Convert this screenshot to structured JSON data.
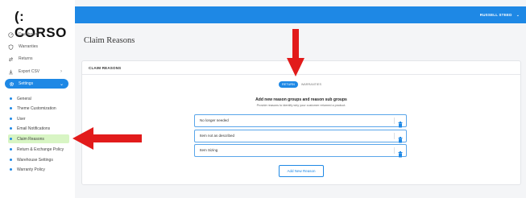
{
  "brand": {
    "logo_text": "CORSO"
  },
  "topbar": {
    "user_name": "RUSSELL STEED"
  },
  "sidebar": {
    "items": [
      {
        "label": "Dashboard",
        "icon": "dashboard-icon"
      },
      {
        "label": "Warranties",
        "icon": "shield-icon"
      },
      {
        "label": "Returns",
        "icon": "returns-icon"
      },
      {
        "label": "Export CSV",
        "icon": "download-icon"
      }
    ],
    "settings_label": "Settings",
    "sub_items": [
      {
        "label": "General"
      },
      {
        "label": "Theme Customization"
      },
      {
        "label": "User"
      },
      {
        "label": "Email Notifications"
      },
      {
        "label": "Claim Reasons"
      },
      {
        "label": "Return & Exchange Policy"
      },
      {
        "label": "Warehouse Settings"
      },
      {
        "label": "Warranty Policy"
      }
    ],
    "active_sub_item": "Claim Reasons"
  },
  "page": {
    "title": "Claim Reasons"
  },
  "card": {
    "header": "CLAIM REASONS",
    "tabs": [
      {
        "label": "RETURN",
        "active": true
      },
      {
        "label": "WARRANTIES",
        "active": false
      }
    ],
    "heading": "Add new reason groups and reason sub groups",
    "subheading": "Provide reasons to identify why your customer returned a product.",
    "reasons": [
      {
        "label": "No longer needed"
      },
      {
        "label": "Item not as described"
      },
      {
        "label": "Item Sizing"
      }
    ],
    "add_button": "Add New Reason"
  },
  "colors": {
    "primary": "#1e88e5",
    "active_highlight": "#d8f5c4",
    "annotation_arrow": "#e21b1b"
  }
}
